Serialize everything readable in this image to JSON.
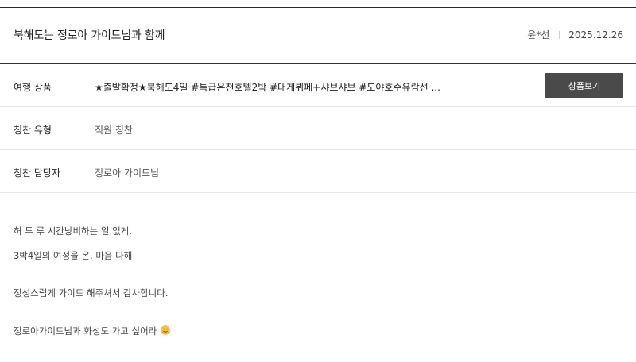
{
  "review": {
    "title": "북해도는 정로아 가이드님과 함께",
    "author": "윤*선",
    "date": "2025.12.26"
  },
  "info": {
    "product_label": "여행 상품",
    "product_value": "★출발확정★북해도4일 #특급온천호텔2박 #대게뷔페+샤브샤브 #도야호수유람선 ...",
    "product_button": "상품보기",
    "type_label": "칭찬 유형",
    "type_value": "직원 칭찬",
    "staff_label": "칭찬 담당자",
    "staff_value": "정로아 가이드님"
  },
  "content": {
    "lines": [
      "허 투 루 시간낭비하는 일 없게.",
      "3박4일의 여정을 온. 마음 다해",
      "정성스럽게 가이드 해주셔서 감사합니다.",
      "정로아가이드님과 화성도 가고 싶어라"
    ],
    "emoji_icon": "hugging-face-icon"
  },
  "colors": {
    "button_bg": "#4a4a4a",
    "divider": "#333333"
  }
}
